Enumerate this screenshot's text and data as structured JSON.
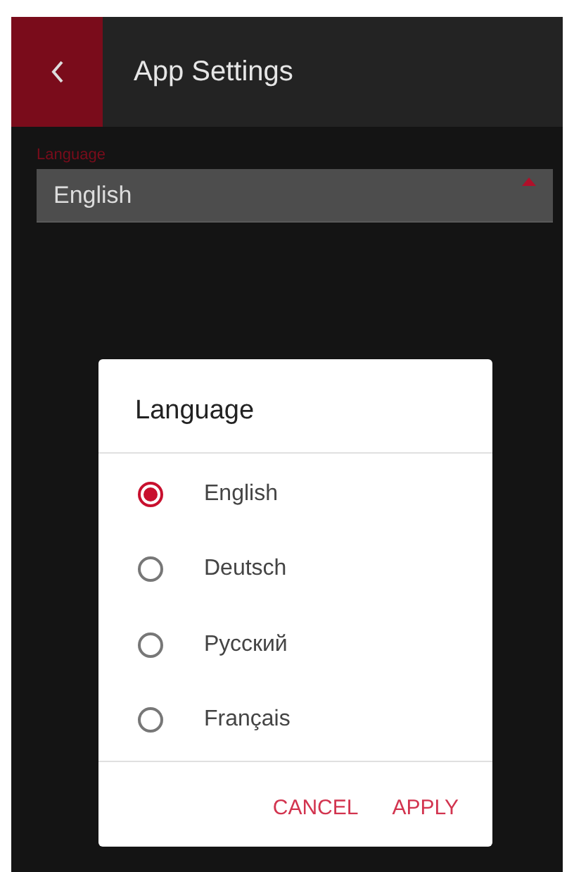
{
  "header": {
    "title": "App Settings"
  },
  "language_field": {
    "label": "Language",
    "value": "English",
    "expanded": true
  },
  "dialog": {
    "title": "Language",
    "options": [
      {
        "label": "English",
        "selected": true
      },
      {
        "label": "Deutsch",
        "selected": false
      },
      {
        "label": "Русский",
        "selected": false
      },
      {
        "label": "Français",
        "selected": false
      }
    ],
    "buttons": [
      "CANCEL",
      "APPLY"
    ]
  }
}
